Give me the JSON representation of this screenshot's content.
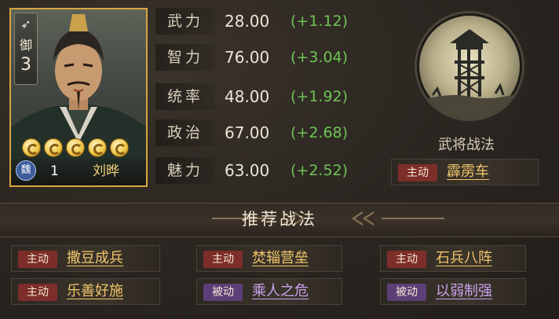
{
  "general": {
    "troop_type": "御",
    "troop_level": "3",
    "cost": "1",
    "faction": "魏",
    "name": "刘晔",
    "stars": 5
  },
  "stats": [
    {
      "label": "武力",
      "value": "28.00",
      "bonus": "(+1.12)"
    },
    {
      "label": "智力",
      "value": "76.00",
      "bonus": "(+3.04)"
    },
    {
      "label": "统率",
      "value": "48.00",
      "bonus": "(+1.92)"
    },
    {
      "label": "政治",
      "value": "67.00",
      "bonus": "(+2.68)"
    },
    {
      "label": "魅力",
      "value": "63.00",
      "bonus": "(+2.52)"
    }
  ],
  "own_skill": {
    "title": "武将战法",
    "type": "主动",
    "name": "霹雳车"
  },
  "recommended": {
    "title": "推荐战法",
    "skills": [
      {
        "type": "主动",
        "name": "撒豆成兵"
      },
      {
        "type": "主动",
        "name": "焚辎营垒"
      },
      {
        "type": "主动",
        "name": "石兵八阵"
      },
      {
        "type": "主动",
        "name": "乐善好施"
      },
      {
        "type": "被动",
        "name": "乘人之危"
      },
      {
        "type": "被动",
        "name": "以弱制强"
      }
    ]
  },
  "colors": {
    "card_border": "#d9a441",
    "bonus_green": "#6fc456",
    "active_tag": "#7d2d2a",
    "passive_tag": "#5d3f78",
    "skill_gold": "#f0c56a",
    "skill_purple": "#c9a3ee"
  }
}
